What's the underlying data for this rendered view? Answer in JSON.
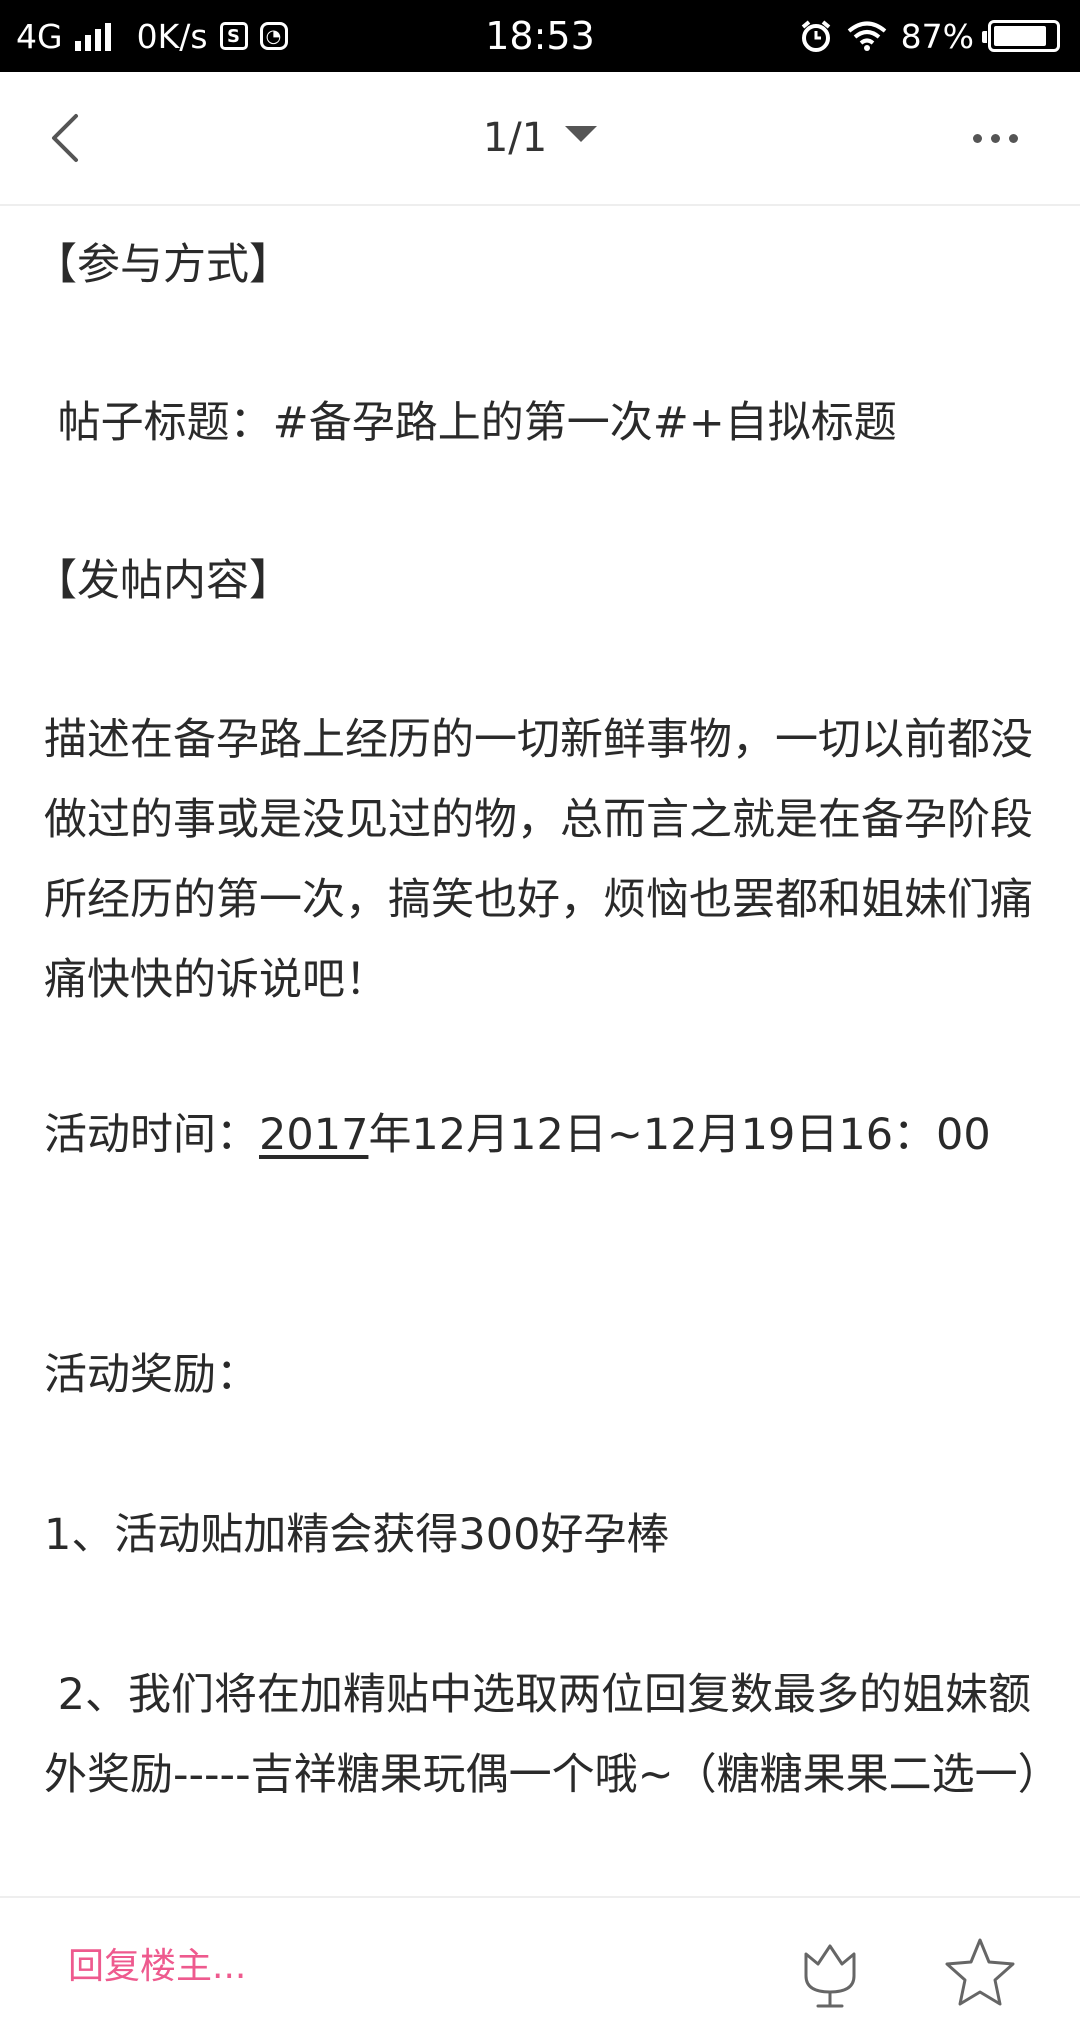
{
  "status_bar": {
    "network": "4G",
    "speed": "0K/s",
    "time": "18:53",
    "battery": "87%",
    "battery_level": 0.87
  },
  "nav": {
    "page_indicator": "1/1"
  },
  "content": {
    "p1": "【参与方式】",
    "p2": " 帖子标题：#备孕路上的第一次#+自拟标题",
    "p3": "【发帖内容】",
    "p4": "描述在备孕路上经历的一切新鲜事物，一切以前都没做过的事或是没见过的物，总而言之就是在备孕阶段所经历的第一次，搞笑也好，烦恼也罢都和姐妹们痛痛快快的诉说吧！",
    "time_label": "活动时间：",
    "time_year": "2017",
    "time_rest": "年12月12日~12月19日16：00",
    "reward_label": "活动奖励：",
    "reward_1": "1、活动贴加精会获得300好孕棒",
    "reward_2": " 2、我们将在加精贴中选取两位回复数最多的姐妹额外奖励-----吉祥糖果玩偶一个哦~（糖糖果果二选一）"
  },
  "bottom_bar": {
    "reply_placeholder": "回复楼主...",
    "accent_color": "#ee5a8e"
  }
}
